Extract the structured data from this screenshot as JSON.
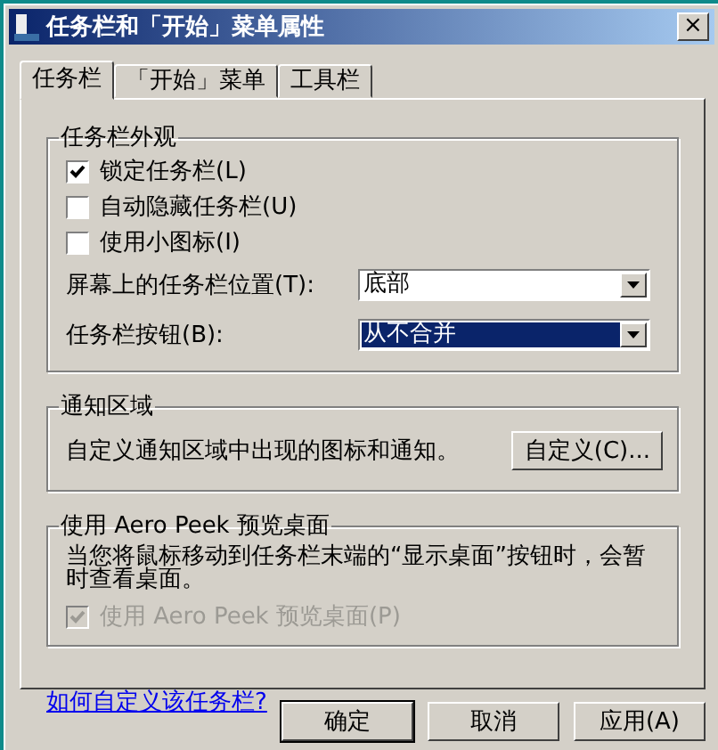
{
  "window": {
    "title": "任务栏和「开始」菜单属性",
    "close": "×"
  },
  "tabs": [
    {
      "label": "任务栏",
      "selected": true
    },
    {
      "label": "「开始」菜单",
      "selected": false
    },
    {
      "label": "工具栏",
      "selected": false
    }
  ],
  "appearance": {
    "title": "任务栏外观",
    "checkboxes": [
      {
        "label": "锁定任务栏(L)",
        "checked": true
      },
      {
        "label": "自动隐藏任务栏(U)",
        "checked": false
      },
      {
        "label": "使用小图标(I)",
        "checked": false
      }
    ],
    "dropdowns": [
      {
        "label": "屏幕上的任务栏位置(T):",
        "value": "底部",
        "focused": false
      },
      {
        "label": "任务栏按钮(B):",
        "value": "从不合并",
        "focused": true
      }
    ]
  },
  "notification": {
    "title": "通知区域",
    "text": "自定义通知区域中出现的图标和通知。",
    "button": "自定义(C)..."
  },
  "peek": {
    "title": "使用 Aero Peek 预览桌面",
    "text": "当您将鼠标移动到任务栏末端的“显示桌面”按钮时，会暂时查看桌面。",
    "checkbox": {
      "label": "使用 Aero Peek 预览桌面(P)",
      "checked": true,
      "disabled": true
    }
  },
  "help_link": "如何自定义该任务栏?",
  "buttons": [
    {
      "label": "确定",
      "default": true
    },
    {
      "label": "取消",
      "default": false
    },
    {
      "label": "应用(A)",
      "default": false
    }
  ]
}
